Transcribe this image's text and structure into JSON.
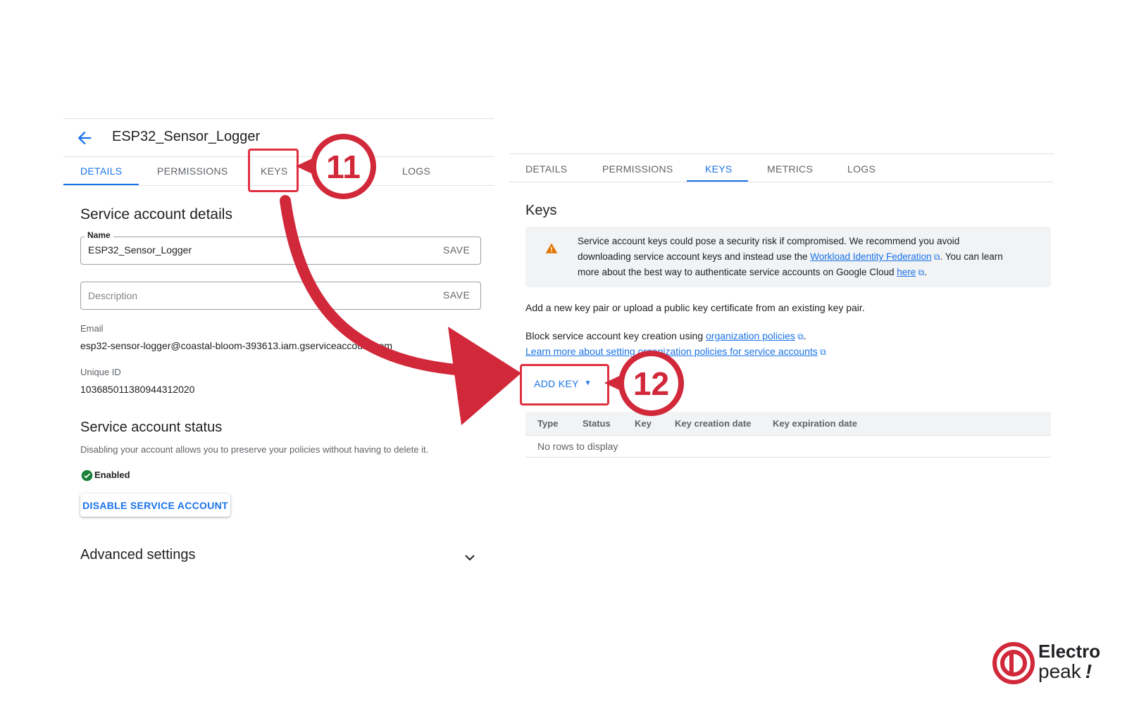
{
  "left": {
    "title": "ESP32_Sensor_Logger",
    "tabs": [
      "DETAILS",
      "PERMISSIONS",
      "KEYS",
      "LOGS"
    ],
    "active_tab": "DETAILS",
    "section_title": "Service account details",
    "name_field": {
      "legend": "Name",
      "value": "ESP32_Sensor_Logger",
      "save": "SAVE"
    },
    "description_field": {
      "placeholder": "Description",
      "save": "SAVE"
    },
    "email": {
      "label": "Email",
      "value": "esp32-sensor-logger@coastal-bloom-393613.iam.gserviceaccount.com"
    },
    "unique_id": {
      "label": "Unique ID",
      "value": "103685011380944312020"
    },
    "status_title": "Service account status",
    "status_desc": "Disabling your account allows you to preserve your policies without having to delete it.",
    "status_value": "Enabled",
    "disable_button": "DISABLE SERVICE ACCOUNT",
    "advanced_title": "Advanced settings"
  },
  "right": {
    "tabs": [
      "DETAILS",
      "PERMISSIONS",
      "KEYS",
      "METRICS",
      "LOGS"
    ],
    "active_tab": "KEYS",
    "section_title": "Keys",
    "warning": {
      "line1": "Service account keys could pose a security risk if compromised. We recommend you avoid",
      "line2a": "downloading service account keys and instead use the ",
      "link1": "Workload Identity Federation",
      "line2b": ". You can learn",
      "line3a": "more about the best way to authenticate service accounts on Google Cloud ",
      "link2": "here",
      "line3b": "."
    },
    "add_info": "Add a new key pair or upload a public key certificate from an existing key pair.",
    "block_text": "Block service account key creation using ",
    "block_link": "organization policies",
    "learn_link": "Learn more about setting organization policies for service accounts",
    "add_key_button": "ADD KEY",
    "table": {
      "headers": [
        "Type",
        "Status",
        "Key",
        "Key creation date",
        "Key expiration date"
      ],
      "empty": "No rows to display"
    }
  },
  "annotations": {
    "step1": "11",
    "step2": "12",
    "accent": "#d1283a"
  },
  "logo": {
    "line1": "Electro",
    "line2": "peak",
    "mark": "!"
  },
  "colors": {
    "primary": "#1a73e8",
    "warning": "#e37400",
    "success": "#188038"
  }
}
